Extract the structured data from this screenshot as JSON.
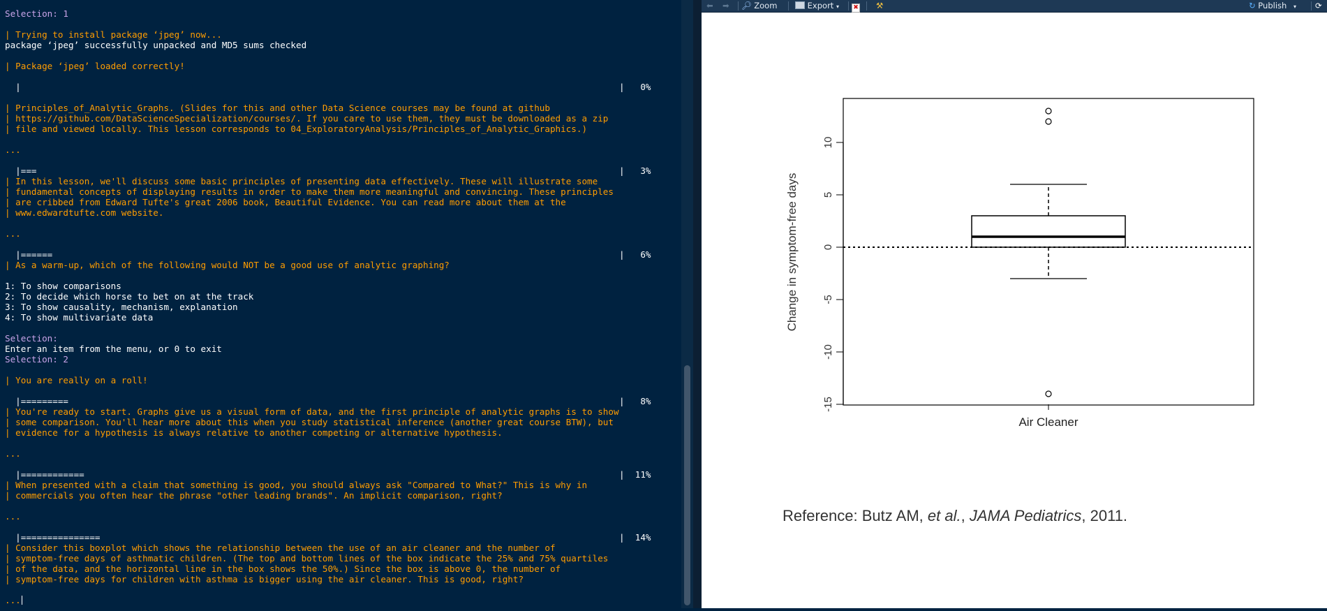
{
  "console": {
    "lines": [
      {
        "t": "Selection: 1",
        "c": "prompt"
      },
      {
        "t": "",
        "c": "out"
      },
      {
        "t": "| Trying to install package ‘jpeg’ now...",
        "c": "sw"
      },
      {
        "t": "package ‘jpeg’ successfully unpacked and MD5 sums checked",
        "c": "out"
      },
      {
        "t": "",
        "c": "out"
      },
      {
        "t": "| Package ‘jpeg’ loaded correctly!",
        "c": "sw"
      },
      {
        "t": "",
        "c": "out"
      },
      {
        "t": "  |",
        "c": "out",
        "pct": "|   0%"
      },
      {
        "t": "",
        "c": "out"
      },
      {
        "t": "| Principles_of_Analytic_Graphs. (Slides for this and other Data Science courses may be found at github",
        "c": "sw"
      },
      {
        "t": "| https://github.com/DataScienceSpecialization/courses/. If you care to use them, they must be downloaded as a zip",
        "c": "sw"
      },
      {
        "t": "| file and viewed locally. This lesson corresponds to 04_ExploratoryAnalysis/Principles_of_Analytic_Graphics.)",
        "c": "sw"
      },
      {
        "t": "",
        "c": "out"
      },
      {
        "t": "...",
        "c": "sw"
      },
      {
        "t": "",
        "c": "out"
      },
      {
        "t": "  |===",
        "c": "out",
        "pct": "|   3%"
      },
      {
        "t": "| In this lesson, we'll discuss some basic principles of presenting data effectively. These will illustrate some",
        "c": "sw"
      },
      {
        "t": "| fundamental concepts of displaying results in order to make them more meaningful and convincing. These principles",
        "c": "sw"
      },
      {
        "t": "| are cribbed from Edward Tufte's great 2006 book, Beautiful Evidence. You can read more about them at the",
        "c": "sw"
      },
      {
        "t": "| www.edwardtufte.com website.",
        "c": "sw"
      },
      {
        "t": "",
        "c": "out"
      },
      {
        "t": "...",
        "c": "sw"
      },
      {
        "t": "",
        "c": "out"
      },
      {
        "t": "  |======",
        "c": "out",
        "pct": "|   6%"
      },
      {
        "t": "| As a warm-up, which of the following would NOT be a good use of analytic graphing?",
        "c": "sw"
      },
      {
        "t": "",
        "c": "out"
      },
      {
        "t": "1: To show comparisons",
        "c": "out"
      },
      {
        "t": "2: To decide which horse to bet on at the track",
        "c": "out"
      },
      {
        "t": "3: To show causality, mechanism, explanation",
        "c": "out"
      },
      {
        "t": "4: To show multivariate data",
        "c": "out"
      },
      {
        "t": "",
        "c": "out"
      },
      {
        "t": "Selection:",
        "c": "prompt"
      },
      {
        "t": "Enter an item from the menu, or 0 to exit",
        "c": "out"
      },
      {
        "t": "Selection: 2",
        "c": "prompt"
      },
      {
        "t": "",
        "c": "out"
      },
      {
        "t": "| You are really on a roll!",
        "c": "sw"
      },
      {
        "t": "",
        "c": "out"
      },
      {
        "t": "  |=========",
        "c": "out",
        "pct": "|   8%"
      },
      {
        "t": "| You're ready to start. Graphs give us a visual form of data, and the first principle of analytic graphs is to show",
        "c": "sw"
      },
      {
        "t": "| some comparison. You'll hear more about this when you study statistical inference (another great course BTW), but",
        "c": "sw"
      },
      {
        "t": "| evidence for a hypothesis is always relative to another competing or alternative hypothesis.",
        "c": "sw"
      },
      {
        "t": "",
        "c": "out"
      },
      {
        "t": "...",
        "c": "sw"
      },
      {
        "t": "",
        "c": "out"
      },
      {
        "t": "  |============",
        "c": "out",
        "pct": "|  11%"
      },
      {
        "t": "| When presented with a claim that something is good, you should always ask \"Compared to What?\" This is why in",
        "c": "sw"
      },
      {
        "t": "| commercials you often hear the phrase \"other leading brands\". An implicit comparison, right?",
        "c": "sw"
      },
      {
        "t": "",
        "c": "out"
      },
      {
        "t": "...",
        "c": "sw"
      },
      {
        "t": "",
        "c": "out"
      },
      {
        "t": "  |===============",
        "c": "out",
        "pct": "|  14%"
      },
      {
        "t": "| Consider this boxplot which shows the relationship between the use of an air cleaner and the number of",
        "c": "sw"
      },
      {
        "t": "| symptom-free days of asthmatic children. (The top and bottom lines of the box indicate the 25% and 75% quartiles",
        "c": "sw"
      },
      {
        "t": "| of the data, and the horizontal line in the box shows the 50%.) Since the box is above 0, the number of",
        "c": "sw"
      },
      {
        "t": "| symptom-free days for children with asthma is bigger using the air cleaner. This is good, right?",
        "c": "sw"
      },
      {
        "t": "",
        "c": "out"
      },
      {
        "t": "...",
        "c": "sw",
        "cursor": true
      }
    ]
  },
  "viewer": {
    "toolbar": {
      "zoom_label": "Zoom",
      "export_label": "Export",
      "publish_label": "Publish"
    },
    "reference": {
      "prefix": "Reference: Butz AM, ",
      "etal": "et al.",
      "sep": ", ",
      "journal": "JAMA Pediatrics",
      "suffix": ", 2011."
    }
  },
  "chart_data": {
    "type": "box",
    "categories": [
      "Air Cleaner"
    ],
    "xlabel": "Air Cleaner",
    "ylabel": "Change in symptom-free days",
    "ylim": [
      -15,
      14
    ],
    "yticks": [
      -15,
      -10,
      -5,
      0,
      5,
      10
    ],
    "box": {
      "whisker_low": -3,
      "q1": 0,
      "median": 1,
      "q3": 3,
      "whisker_high": 6
    },
    "outliers": [
      13,
      12,
      -14
    ],
    "reference_line": 0,
    "colors": {
      "axis": "#000000",
      "box": "#000000"
    }
  }
}
